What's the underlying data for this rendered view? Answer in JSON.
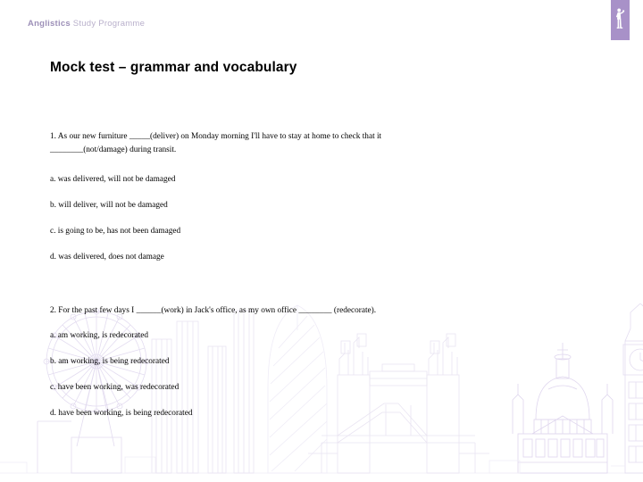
{
  "header": {
    "brand": "Anglistics",
    "subtitle": " Study Programme",
    "accent_color": "#a891c8",
    "text_color": "#b5abc9",
    "logo_icon": "standing-figure-icon"
  },
  "title": "Mock test – grammar and vocabulary",
  "background": {
    "watermark": "london-skyline-watermark",
    "landmarks": [
      "london-eye",
      "gherkin",
      "tower-bridge",
      "st-pauls-cathedral",
      "big-ben"
    ],
    "line_color": "#e9e5f2"
  },
  "questions": [
    {
      "number": "1.",
      "stem_line1": "1.  As  our  new  furniture  _____(deliver)  on  Monday  morning  I'll  have  to  stay  at  home  to  check  that  it",
      "stem_line2": "________(not/damage) during transit.",
      "options": [
        "a. was delivered, will not be damaged",
        "b. will deliver, will not be damaged",
        "c. is going to be, has not been damaged",
        "d. was delivered, does not damage"
      ]
    },
    {
      "number": "2.",
      "stem_line1": "2. For the past few days I ______(work) in Jack's office, as my own office ________ (redecorate).",
      "stem_line2": "",
      "options": [
        "a. am working, is redecorated",
        "b. am working, is being redecorated",
        "c. have been working, was redecorated",
        "d. have been working, is being redecorated"
      ]
    }
  ]
}
